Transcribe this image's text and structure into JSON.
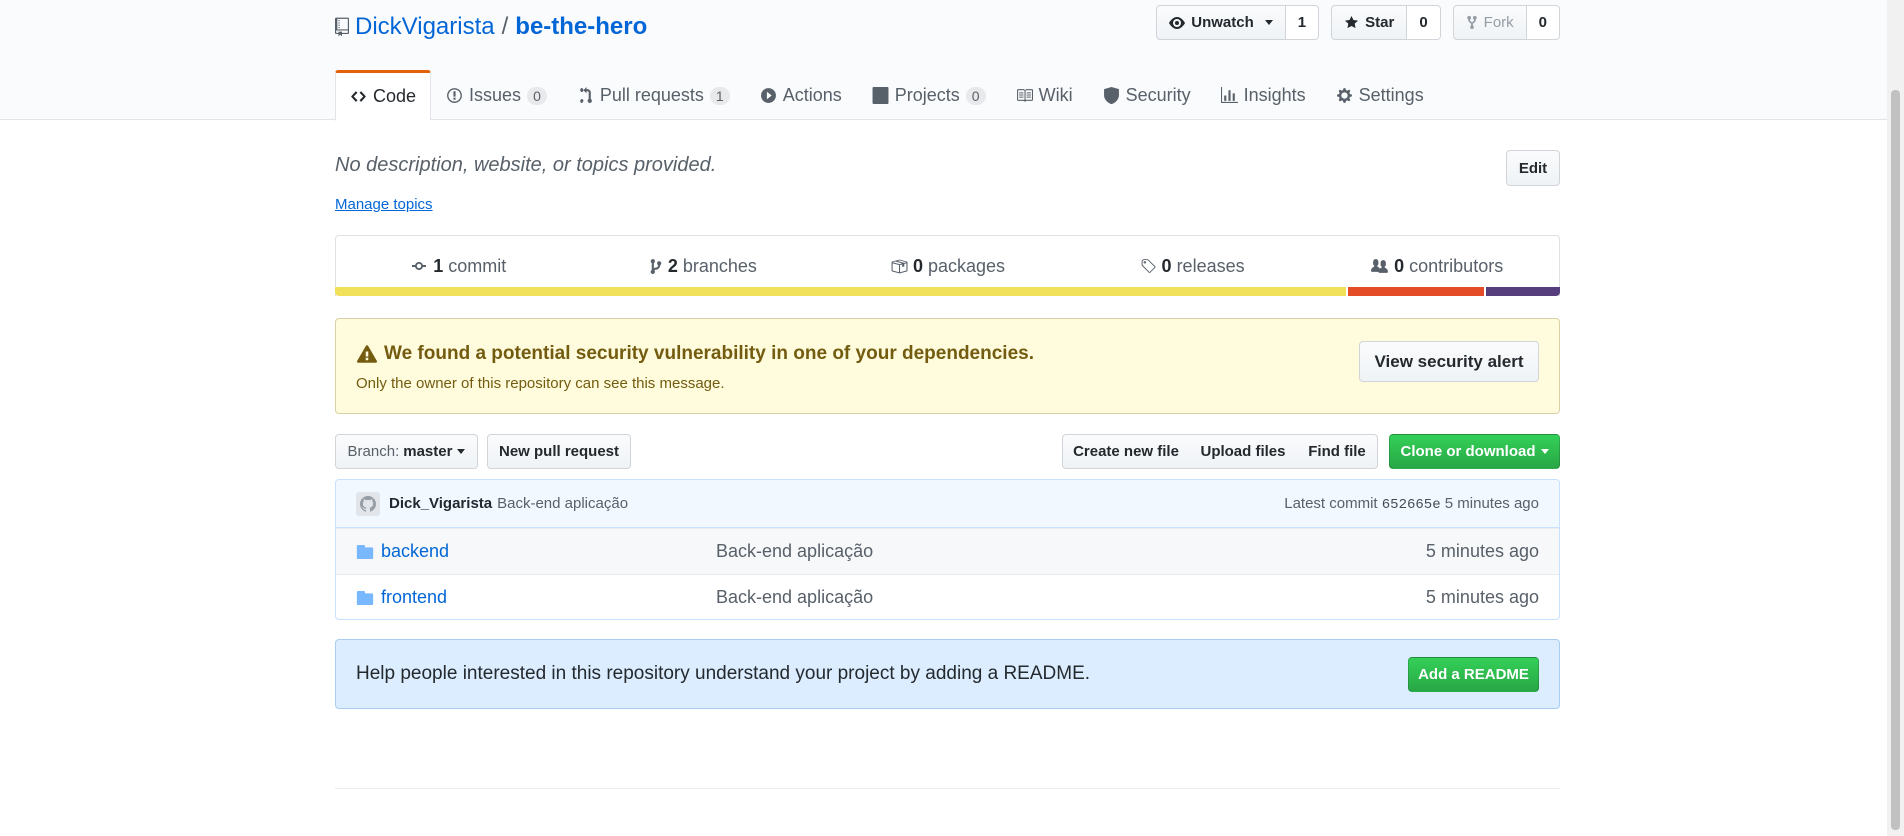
{
  "repo": {
    "owner": "DickVigarista",
    "separator": "/",
    "name": "be-the-hero"
  },
  "actions": {
    "watch_label": "Unwatch",
    "watch_count": "1",
    "star_label": "Star",
    "star_count": "0",
    "fork_label": "Fork",
    "fork_count": "0"
  },
  "tabs": [
    {
      "label": "Code",
      "icon": "code-icon",
      "counter": null
    },
    {
      "label": "Issues",
      "icon": "issue-icon",
      "counter": "0"
    },
    {
      "label": "Pull requests",
      "icon": "pull-request-icon",
      "counter": "1"
    },
    {
      "label": "Actions",
      "icon": "play-icon",
      "counter": null
    },
    {
      "label": "Projects",
      "icon": "project-icon",
      "counter": "0"
    },
    {
      "label": "Wiki",
      "icon": "book-icon",
      "counter": null
    },
    {
      "label": "Security",
      "icon": "shield-icon",
      "counter": null
    },
    {
      "label": "Insights",
      "icon": "graph-icon",
      "counter": null
    },
    {
      "label": "Settings",
      "icon": "gear-icon",
      "counter": null
    }
  ],
  "description": "No description, website, or topics provided.",
  "manage_topics": "Manage topics",
  "edit_label": "Edit",
  "summary": {
    "commits_num": "1",
    "commits_label": "commit",
    "branches_num": "2",
    "branches_label": "branches",
    "packages_num": "0",
    "packages_label": "packages",
    "releases_num": "0",
    "releases_label": "releases",
    "contributors_num": "0",
    "contributors_label": "contributors"
  },
  "language_bar": [
    {
      "color": "#f1e05a",
      "share": 0.828
    },
    {
      "color": "#e34c26",
      "share": 0.111
    },
    {
      "color": "#563d7c",
      "share": 0.061
    }
  ],
  "alert": {
    "title": "We found a potential security vulnerability in one of your dependencies.",
    "subtitle": "Only the owner of this repository can see this message.",
    "button": "View security alert"
  },
  "filenav": {
    "branch_label": "Branch:",
    "branch_value": "master",
    "new_pr": "New pull request",
    "create_file": "Create new file",
    "upload_files": "Upload files",
    "find_file": "Find file",
    "clone": "Clone or download"
  },
  "commit": {
    "author": "Dick_Vigarista",
    "message": "Back-end aplicação",
    "latest_label": "Latest commit",
    "sha": "652665e",
    "age": "5 minutes ago"
  },
  "files": [
    {
      "name": "backend",
      "message": "Back-end aplicação",
      "age": "5 minutes ago"
    },
    {
      "name": "frontend",
      "message": "Back-end aplicação",
      "age": "5 minutes ago"
    }
  ],
  "readme": {
    "text": "Help people interested in this repository understand your project by adding a README.",
    "button": "Add a README"
  }
}
